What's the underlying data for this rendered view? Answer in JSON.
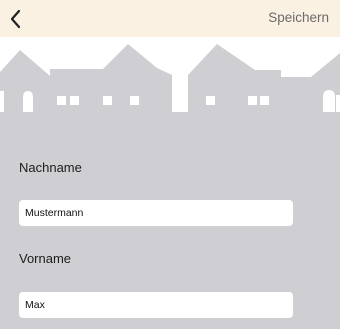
{
  "nav": {
    "back_icon": "chevron-left-icon",
    "save_label": "Speichern"
  },
  "form": {
    "lastname": {
      "label": "Nachname",
      "value": "Mustermann"
    },
    "firstname": {
      "label": "Vorname",
      "value": "Max"
    }
  },
  "colors": {
    "nav_background": "#fbf1e3",
    "form_background": "#cfcfd3",
    "skyline": "#ffffff"
  }
}
